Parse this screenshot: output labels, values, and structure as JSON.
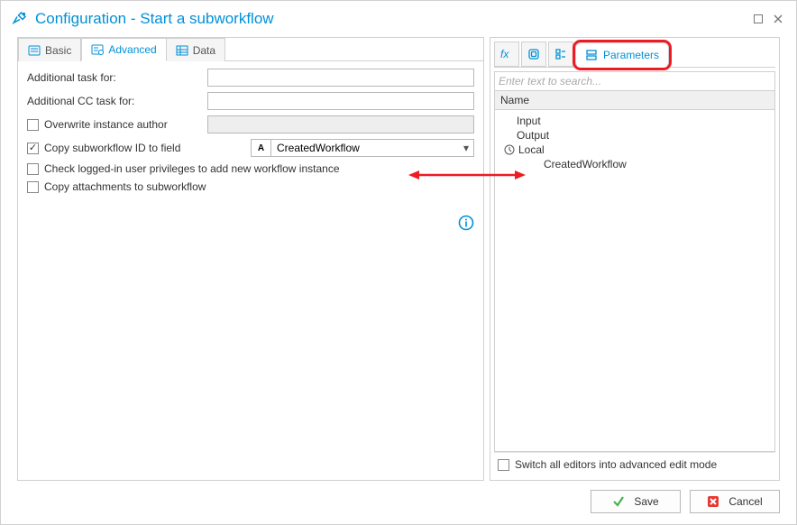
{
  "window": {
    "title": "Configuration - Start a subworkflow"
  },
  "left": {
    "tabs": {
      "basic": "Basic",
      "advanced": "Advanced",
      "data": "Data"
    },
    "labels": {
      "addTask": "Additional task for:",
      "addCC": "Additional CC task for:",
      "overwrite": "Overwrite instance author",
      "copyId": "Copy subworkflow ID to field",
      "checkPriv": "Check logged-in user privileges to add new workflow instance",
      "copyAtt": "Copy attachments to subworkflow"
    },
    "values": {
      "addTask": "",
      "addCC": "",
      "overwriteField": ""
    },
    "copyField": {
      "badge": "A",
      "name": "CreatedWorkflow"
    },
    "checks": {
      "overwrite": false,
      "copyId": true,
      "checkPriv": false,
      "copyAtt": false
    }
  },
  "right": {
    "paramTab": "Parameters",
    "searchPlaceholder": "Enter text to search...",
    "col": "Name",
    "tree": {
      "input": "Input",
      "output": "Output",
      "local": "Local",
      "created": "CreatedWorkflow"
    },
    "advSwitch": "Switch all editors into advanced edit mode",
    "advChecked": false
  },
  "buttons": {
    "save": "Save",
    "cancel": "Cancel"
  }
}
